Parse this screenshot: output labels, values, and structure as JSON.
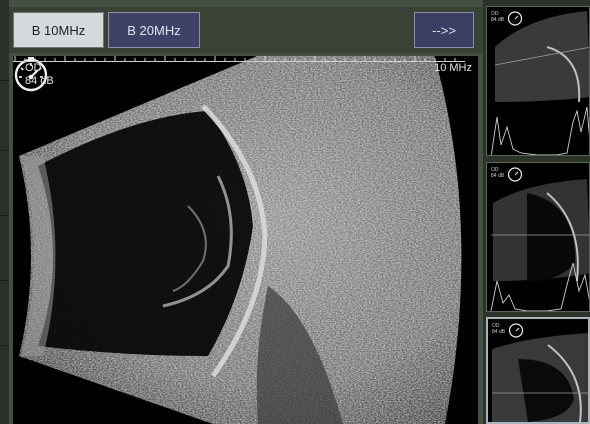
{
  "toolbar": {
    "tab_10": "B 10MHz",
    "tab_20": "B 20MHz",
    "next_label": "-->>"
  },
  "main": {
    "eye": "OD",
    "gain": "84 dB",
    "frequency": "10 MHz"
  },
  "thumbnails": [
    {
      "eye": "OD",
      "gain": "84 dB"
    },
    {
      "eye": "OD",
      "gain": "84 dB"
    },
    {
      "eye": "OD",
      "gain": "84 dB"
    }
  ],
  "colors": {
    "selected_tab": "#d6d9dc",
    "tab_blue": "#3f4266",
    "panel_green": "#454f42"
  }
}
